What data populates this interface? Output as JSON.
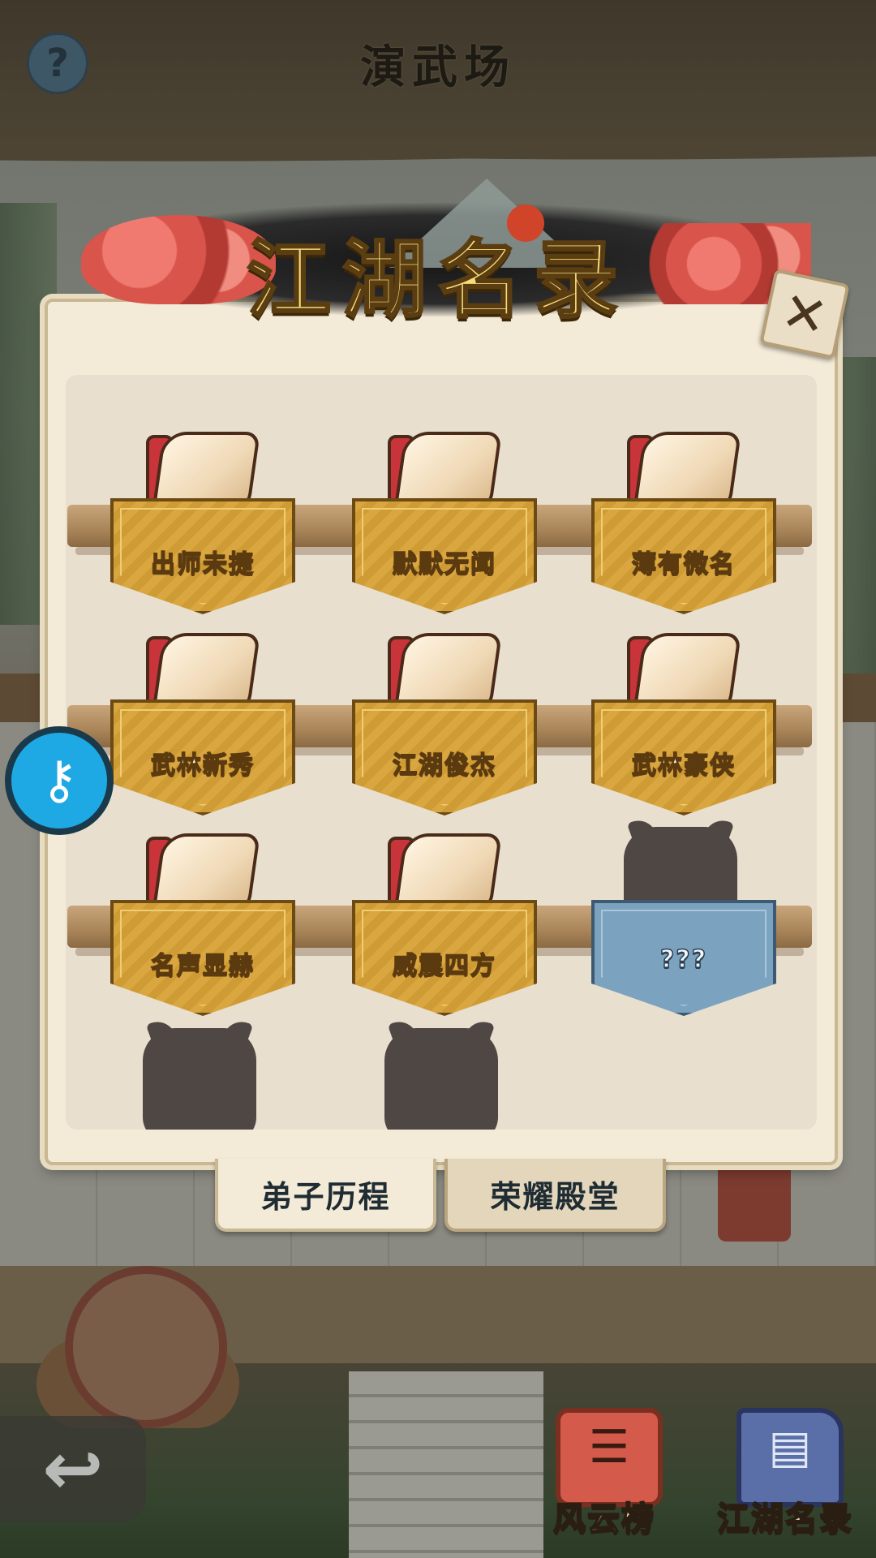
{
  "header": {
    "title": "演武场",
    "help_icon": "help-icon"
  },
  "dialog": {
    "title": "江湖名录",
    "close_icon": "close-icon",
    "items": [
      {
        "label": "出师未捷",
        "unlocked": true
      },
      {
        "label": "默默无闻",
        "unlocked": true
      },
      {
        "label": "薄有微名",
        "unlocked": true
      },
      {
        "label": "武林新秀",
        "unlocked": true
      },
      {
        "label": "江湖俊杰",
        "unlocked": true
      },
      {
        "label": "武林豪侠",
        "unlocked": true
      },
      {
        "label": "名声显赫",
        "unlocked": true
      },
      {
        "label": "威震四方",
        "unlocked": true
      },
      {
        "label": "???",
        "unlocked": false
      }
    ],
    "tabs": [
      {
        "label": "弟子历程",
        "active": true
      },
      {
        "label": "荣耀殿堂",
        "active": false
      }
    ]
  },
  "side": {
    "key_icon": "key-icon"
  },
  "bottom_nav": {
    "back_icon": "back-arrow-icon",
    "items": [
      {
        "label": "风云榜",
        "icon": "ranking-scroll-icon"
      },
      {
        "label": "江湖名录",
        "icon": "book-icon"
      }
    ]
  },
  "colors": {
    "plaque_gold": "#d9a640",
    "plaque_locked": "#7ba3bf",
    "key_button": "#1ea9e4",
    "dialog_bg": "#f3ead7"
  }
}
